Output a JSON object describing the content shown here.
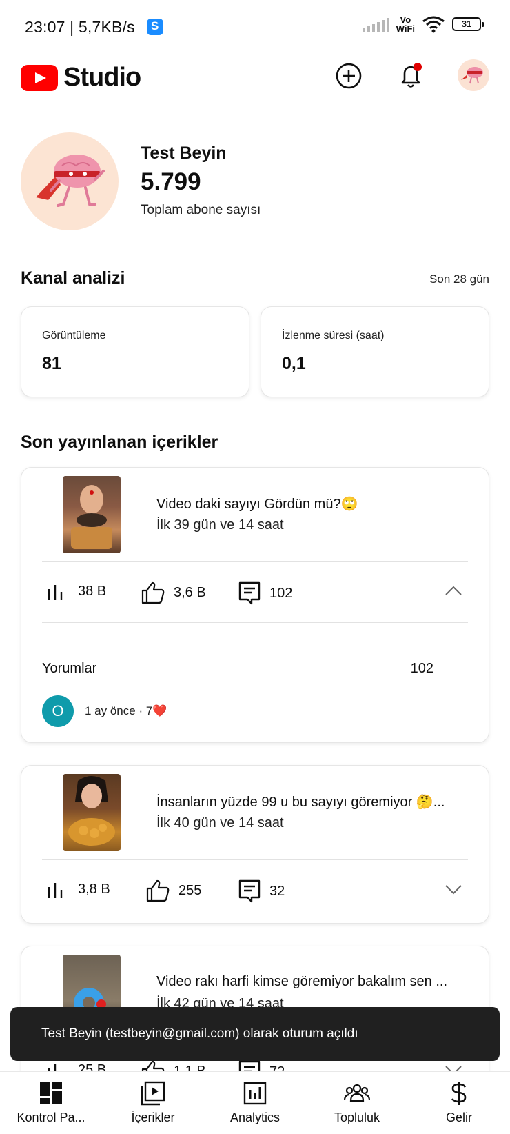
{
  "status_bar": {
    "time": "23:07",
    "net_speed": "5,7KB/s",
    "vowifi": "Vo\nWiFi",
    "battery": "31"
  },
  "app_bar": {
    "brand": "Studio"
  },
  "channel": {
    "name": "Test Beyin",
    "subscribers": "5.799",
    "subscribers_label": "Toplam abone sayısı"
  },
  "analytics": {
    "title": "Kanal analizi",
    "period": "Son 28 gün",
    "cards": [
      {
        "label": "Görüntüleme",
        "value": "81"
      },
      {
        "label": "İzlenme süresi (saat)",
        "value": "0,1"
      }
    ]
  },
  "recent": {
    "title": "Son yayınlanan içerikler",
    "videos": [
      {
        "title": "Video daki sayıyı Gördün mü?🙄",
        "age": "İlk 39 gün ve 14 saat",
        "views": "38 B",
        "likes": "3,6 B",
        "comments": "102",
        "expanded": true,
        "comments_label": "Yorumlar",
        "comments_count": "102",
        "commenter_initial": "O",
        "comment_meta": "1 ay önce · 7❤️"
      },
      {
        "title": "İnsanların yüzde 99 u bu sayıyı göremiyor 🤔...",
        "age": "İlk 40 gün ve 14 saat",
        "views": "3,8 B",
        "likes": "255",
        "comments": "32",
        "expanded": false
      },
      {
        "title": "Video rakı harfi kimse göremiyor bakalım sen ...",
        "age": "İlk 42 gün ve 14 saat",
        "views": "25 B",
        "likes": "1,1 B",
        "comments": "72",
        "expanded": false
      }
    ]
  },
  "toast": {
    "text": "Test Beyin (testbeyin@gmail.com) olarak oturum açıldı"
  },
  "bottom_nav": [
    {
      "label": "Kontrol Pa...",
      "icon": "dashboard-icon"
    },
    {
      "label": "İçerikler",
      "icon": "content-icon"
    },
    {
      "label": "Analytics",
      "icon": "analytics-icon"
    },
    {
      "label": "Topluluk",
      "icon": "community-icon"
    },
    {
      "label": "Gelir",
      "icon": "earn-icon"
    }
  ],
  "colors": {
    "brand_red": "#ff0000",
    "notification_dot": "#e00000",
    "commenter_avatar": "#0f9bab",
    "toast_bg": "#202020"
  }
}
